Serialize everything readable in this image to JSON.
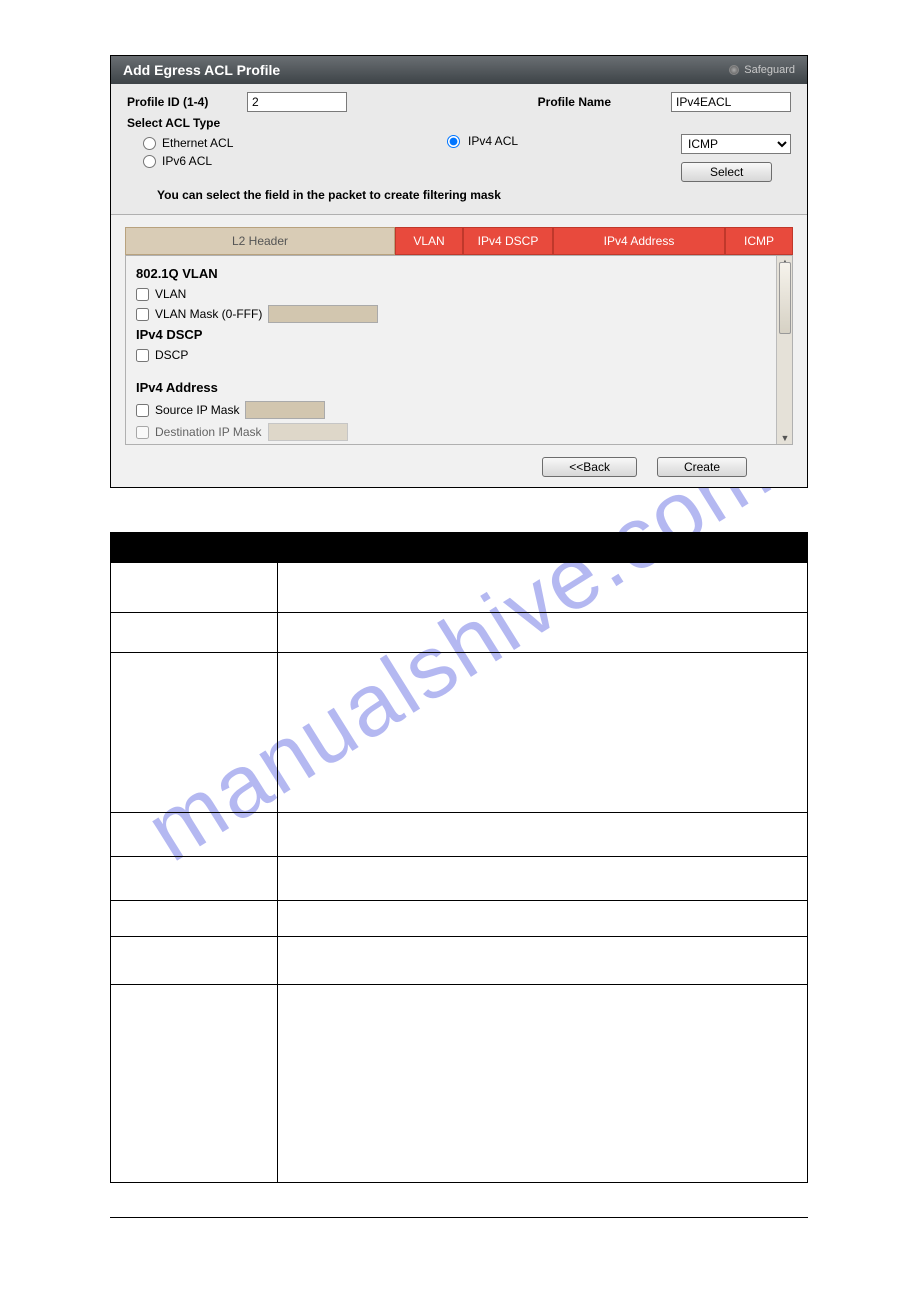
{
  "watermark": "manualshive.com",
  "window": {
    "title": "Add Egress ACL Profile",
    "safeguard": "Safeguard"
  },
  "config": {
    "profile_id_label": "Profile ID (1-4)",
    "profile_id_value": "2",
    "profile_name_label": "Profile Name",
    "profile_name_value": "IPv4EACL",
    "select_acl_type_label": "Select ACL Type",
    "ethernet_acl_label": "Ethernet ACL",
    "ipv4_acl_label": "IPv4 ACL",
    "ipv6_acl_label": "IPv6 ACL",
    "protocol_dropdown_value": "ICMP",
    "select_button": "Select",
    "hint": "You can select the field in the packet to create filtering mask"
  },
  "tabs": {
    "l2": "L2 Header",
    "vlan": "VLAN",
    "dscp": "IPv4 DSCP",
    "ipv4addr": "IPv4 Address",
    "icmp": "ICMP"
  },
  "form": {
    "section_8021q": "802.1Q VLAN",
    "vlan_label": "VLAN",
    "vlan_mask_label": "VLAN Mask (0-FFF)",
    "section_dscp": "IPv4 DSCP",
    "dscp_label": "DSCP",
    "section_ipv4addr": "IPv4 Address",
    "source_ip_mask_label": "Source IP Mask",
    "dest_ip_mask_label": "Destination IP Mask"
  },
  "footer": {
    "back": "<<Back",
    "create": "Create"
  }
}
